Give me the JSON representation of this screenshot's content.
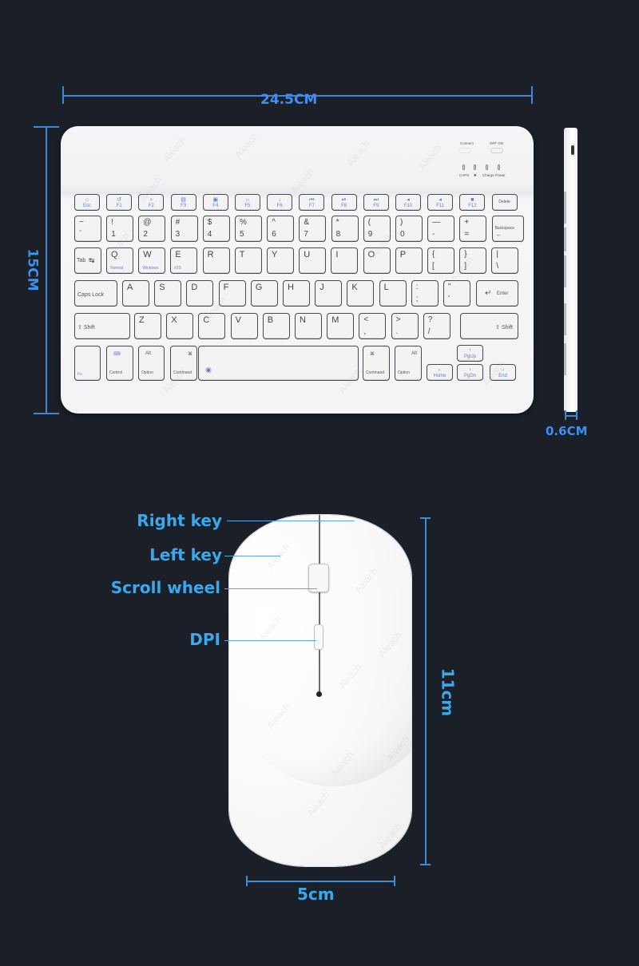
{
  "keyboard": {
    "width_label": "24.5CM",
    "height_label": "15CM",
    "thickness_label": "0.6CM",
    "status_panel": {
      "connect_label": "Connect",
      "switch_label": "OFF ON",
      "indicators": [
        "CAPS",
        "✱",
        "Charge",
        "Power"
      ]
    },
    "rows": {
      "fn": [
        {
          "icon": "⌂",
          "label": "Esc"
        },
        {
          "icon": "↺",
          "label": "F1"
        },
        {
          "icon": "⌕",
          "label": "F2"
        },
        {
          "icon": "▤",
          "label": "F3"
        },
        {
          "icon": "▣",
          "label": "F4"
        },
        {
          "icon": "☼",
          "label": "F5"
        },
        {
          "icon": "↓",
          "label": "F6"
        },
        {
          "icon": "⏮",
          "label": "F7"
        },
        {
          "icon": "⏯",
          "label": "F8"
        },
        {
          "icon": "⏭",
          "label": "F9"
        },
        {
          "icon": "◂",
          "label": "F10"
        },
        {
          "icon": "◂",
          "label": "F11"
        },
        {
          "icon": "■",
          "label": "F12"
        },
        {
          "icon": "",
          "label": "Delete"
        }
      ],
      "number": [
        {
          "top": "~",
          "bottom": "`"
        },
        {
          "top": "!",
          "bottom": "1"
        },
        {
          "top": "@",
          "bottom": "2"
        },
        {
          "top": "#",
          "bottom": "3"
        },
        {
          "top": "$",
          "bottom": "4"
        },
        {
          "top": "%",
          "bottom": "5"
        },
        {
          "top": "^",
          "bottom": "6"
        },
        {
          "top": "&",
          "bottom": "7"
        },
        {
          "top": "*",
          "bottom": "8"
        },
        {
          "top": "(",
          "bottom": "9"
        },
        {
          "top": ")",
          "bottom": "0"
        },
        {
          "top": "—",
          "bottom": "-"
        },
        {
          "top": "+",
          "bottom": "="
        },
        {
          "top": "Backspace",
          "bottom": "←"
        }
      ],
      "qwerty": [
        {
          "top": "Tab",
          "bottom": "↹"
        },
        {
          "top": "Q",
          "sub": "Normal"
        },
        {
          "top": "W",
          "sub": "Windows"
        },
        {
          "top": "E",
          "sub": "iOS"
        },
        {
          "top": "R"
        },
        {
          "top": "T"
        },
        {
          "top": "Y"
        },
        {
          "top": "U"
        },
        {
          "top": "I"
        },
        {
          "top": "O"
        },
        {
          "top": "P"
        },
        {
          "top": "{",
          "bottom": "["
        },
        {
          "top": "}",
          "bottom": "]"
        },
        {
          "top": "|",
          "bottom": "\\"
        }
      ],
      "home": [
        {
          "top": "Caps Lock"
        },
        {
          "top": "A"
        },
        {
          "top": "S"
        },
        {
          "top": "D"
        },
        {
          "top": "F"
        },
        {
          "top": "G"
        },
        {
          "top": "H"
        },
        {
          "top": "J"
        },
        {
          "top": "K"
        },
        {
          "top": "L"
        },
        {
          "top": ":",
          "bottom": ";"
        },
        {
          "top": "\"",
          "bottom": "'"
        },
        {
          "top": "Enter",
          "bottom": "↵"
        }
      ],
      "shift": [
        {
          "top": "⇧ Shift"
        },
        {
          "top": "Z"
        },
        {
          "top": "X"
        },
        {
          "top": "C"
        },
        {
          "top": "V"
        },
        {
          "top": "B"
        },
        {
          "top": "N"
        },
        {
          "top": "M"
        },
        {
          "top": "<",
          "bottom": ","
        },
        {
          "top": ">",
          "bottom": "."
        },
        {
          "top": "?",
          "bottom": "/"
        },
        {
          "top": "⇧ Shift"
        }
      ],
      "bottom": [
        {
          "top": "",
          "bottom": "Fn"
        },
        {
          "top": "⌨",
          "bottom": "Control"
        },
        {
          "top": "Alt",
          "bottom": "Option"
        },
        {
          "top": "⌘",
          "bottom": "Command"
        },
        {
          "top": "◉",
          "bottom": ""
        },
        {
          "top": "⌘",
          "bottom": "Command"
        },
        {
          "top": "Alt",
          "bottom": "Option"
        }
      ],
      "arrows": [
        {
          "icon": "↑",
          "label": "PgUp"
        },
        {
          "icon": "←",
          "label": "Home"
        },
        {
          "icon": "↓",
          "label": "PgDn"
        },
        {
          "icon": "→",
          "label": "End"
        }
      ]
    }
  },
  "mouse": {
    "height_label": "11cm",
    "width_label": "5cm",
    "callouts": [
      {
        "label": "Right key"
      },
      {
        "label": "Left key"
      },
      {
        "label": "Scroll wheel"
      },
      {
        "label": "DPI"
      }
    ]
  },
  "watermark": "Aieach",
  "colors": {
    "background": "#1b1f28",
    "dimension_blue": "#3f8ff0",
    "callout_blue": "#3aa8ec"
  }
}
